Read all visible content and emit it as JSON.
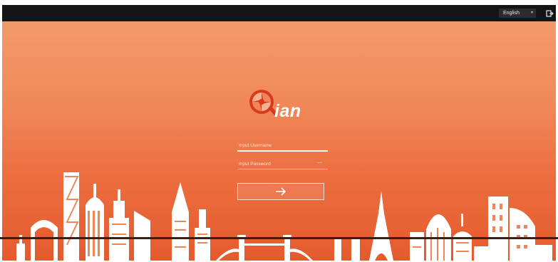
{
  "header": {
    "language": {
      "selected": "English"
    }
  },
  "login": {
    "logo_text": "ian",
    "username": {
      "placeholder": "Input Username",
      "value": ""
    },
    "password": {
      "placeholder": "Input Password",
      "value": ""
    },
    "submit": {
      "icon": "arrow-right-icon"
    }
  },
  "colors": {
    "header_bg": "#131416",
    "gradient_top": "#f39a6a",
    "gradient_bottom": "#e45a2e",
    "logo_red": "#d83a1f",
    "foreground": "#ffffff"
  }
}
